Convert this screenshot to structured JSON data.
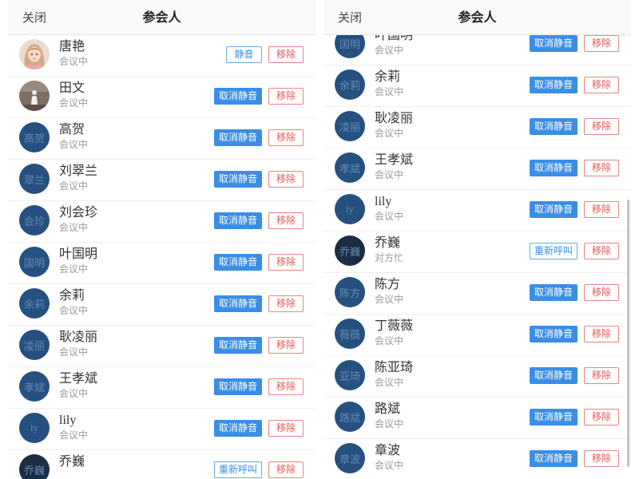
{
  "colors": {
    "primary": "#3a8ee6",
    "primary_light": "#6aa8ea",
    "danger": "#e25a5a",
    "danger_light": "#e88585",
    "avatar_bg": "#25507f"
  },
  "panels": [
    {
      "header": {
        "close_label": "关闭",
        "title": "参会人"
      },
      "participants": [
        {
          "name": "唐艳",
          "status": "会议中",
          "avatar": {
            "type": "photo",
            "icon": "girl-photo-icon"
          },
          "action": {
            "label": "静音",
            "variant": "outline"
          },
          "remove_label": "移除"
        },
        {
          "name": "田文",
          "status": "会议中",
          "avatar": {
            "type": "photo",
            "icon": "person-photo-icon"
          },
          "action": {
            "label": "取消静音",
            "variant": "filled"
          },
          "remove_label": "移除"
        },
        {
          "name": "高贺",
          "status": "会议中",
          "avatar": {
            "type": "initials",
            "text": "高贺"
          },
          "action": {
            "label": "取消静音",
            "variant": "filled"
          },
          "remove_label": "移除"
        },
        {
          "name": "刘翠兰",
          "status": "会议中",
          "avatar": {
            "type": "initials",
            "text": "翠兰"
          },
          "action": {
            "label": "取消静音",
            "variant": "filled"
          },
          "remove_label": "移除"
        },
        {
          "name": "刘会珍",
          "status": "会议中",
          "avatar": {
            "type": "initials",
            "text": "会珍"
          },
          "action": {
            "label": "取消静音",
            "variant": "filled"
          },
          "remove_label": "移除"
        },
        {
          "name": "叶国明",
          "status": "会议中",
          "avatar": {
            "type": "initials",
            "text": "国明"
          },
          "action": {
            "label": "取消静音",
            "variant": "filled"
          },
          "remove_label": "移除"
        },
        {
          "name": "余莉",
          "status": "会议中",
          "avatar": {
            "type": "initials",
            "text": "余莉"
          },
          "action": {
            "label": "取消静音",
            "variant": "filled"
          },
          "remove_label": "移除"
        },
        {
          "name": "耿凌丽",
          "status": "会议中",
          "avatar": {
            "type": "initials",
            "text": "凌丽"
          },
          "action": {
            "label": "取消静音",
            "variant": "filled"
          },
          "remove_label": "移除"
        },
        {
          "name": "王孝斌",
          "status": "会议中",
          "avatar": {
            "type": "initials",
            "text": "孝斌"
          },
          "action": {
            "label": "取消静音",
            "variant": "filled"
          },
          "remove_label": "移除"
        },
        {
          "name": "lily",
          "status": "会议中",
          "avatar": {
            "type": "initials",
            "text": "ly"
          },
          "action": {
            "label": "取消静音",
            "variant": "filled"
          },
          "remove_label": "移除"
        },
        {
          "name": "乔巍",
          "avatar": {
            "type": "initials",
            "text": "乔巍",
            "bg": "#1c2c42"
          },
          "action": {
            "label": "重新呼叫",
            "variant": "outline"
          },
          "remove_label": "移除"
        }
      ]
    },
    {
      "header": {
        "close_label": "关闭",
        "title": "参会人"
      },
      "participants": [
        {
          "name": "叶国明",
          "status": "会议中",
          "avatar": {
            "type": "initials",
            "text": "国明"
          },
          "action": {
            "label": "取消静音",
            "variant": "filled"
          },
          "remove_label": "移除"
        },
        {
          "name": "余莉",
          "status": "会议中",
          "avatar": {
            "type": "initials",
            "text": "余莉"
          },
          "action": {
            "label": "取消静音",
            "variant": "filled"
          },
          "remove_label": "移除"
        },
        {
          "name": "耿凌丽",
          "status": "会议中",
          "avatar": {
            "type": "initials",
            "text": "凌丽"
          },
          "action": {
            "label": "取消静音",
            "variant": "filled"
          },
          "remove_label": "移除"
        },
        {
          "name": "王孝斌",
          "status": "会议中",
          "avatar": {
            "type": "initials",
            "text": "孝斌"
          },
          "action": {
            "label": "取消静音",
            "variant": "filled"
          },
          "remove_label": "移除"
        },
        {
          "name": "lily",
          "status": "会议中",
          "avatar": {
            "type": "initials",
            "text": "ly"
          },
          "action": {
            "label": "取消静音",
            "variant": "filled"
          },
          "remove_label": "移除"
        },
        {
          "name": "乔巍",
          "status": "对方忙",
          "avatar": {
            "type": "initials",
            "text": "乔巍",
            "bg": "#1c2c42"
          },
          "action": {
            "label": "重新呼叫",
            "variant": "outline"
          },
          "remove_label": "移除"
        },
        {
          "name": "陈方",
          "status": "会议中",
          "avatar": {
            "type": "initials",
            "text": "陈方"
          },
          "action": {
            "label": "取消静音",
            "variant": "filled"
          },
          "remove_label": "移除"
        },
        {
          "name": "丁薇薇",
          "status": "会议中",
          "avatar": {
            "type": "initials",
            "text": "薇薇"
          },
          "action": {
            "label": "取消静音",
            "variant": "filled"
          },
          "remove_label": "移除"
        },
        {
          "name": "陈亚琦",
          "status": "会议中",
          "avatar": {
            "type": "initials",
            "text": "亚琦"
          },
          "action": {
            "label": "取消静音",
            "variant": "filled"
          },
          "remove_label": "移除"
        },
        {
          "name": "路斌",
          "status": "会议中",
          "avatar": {
            "type": "initials",
            "text": "路斌"
          },
          "action": {
            "label": "取消静音",
            "variant": "filled"
          },
          "remove_label": "移除"
        },
        {
          "name": "章波",
          "status": "会议中",
          "avatar": {
            "type": "initials",
            "text": "章波"
          },
          "action": {
            "label": "取消静音",
            "variant": "filled"
          },
          "remove_label": "移除"
        }
      ]
    }
  ]
}
